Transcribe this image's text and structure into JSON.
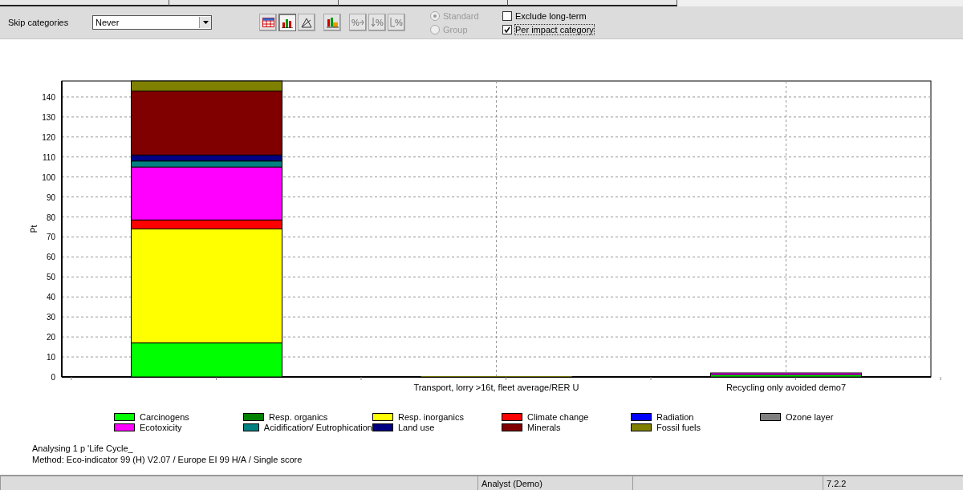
{
  "toolbar": {
    "skip_label": "Skip categories",
    "skip_select": {
      "value": "Never"
    },
    "view_buttons": [
      {
        "kind": "table",
        "selected": false
      },
      {
        "kind": "chart",
        "selected": true
      },
      {
        "kind": "triangle",
        "selected": false
      }
    ],
    "tool_buttons": [
      {
        "kind": "chart-settings",
        "disabled": false
      },
      {
        "kind": "percent",
        "glyph": "%",
        "disabled": true
      },
      {
        "kind": "percent-down",
        "glyph": "%",
        "disabled": true
      },
      {
        "kind": "percent-arrow",
        "glyph": "%",
        "disabled": true
      }
    ],
    "radios": [
      {
        "label": "Standard",
        "selected": true,
        "disabled": true
      },
      {
        "label": "Group",
        "selected": false,
        "disabled": true
      }
    ],
    "checkboxes": [
      {
        "label": "Exclude long-term",
        "checked": false,
        "focused": false
      },
      {
        "label": "Per impact category",
        "checked": true,
        "focused": true
      }
    ]
  },
  "chart": {
    "chart_data": {
      "type": "bar",
      "stacked": true,
      "grid": true,
      "ylabel": "Pt",
      "categories": [
        null,
        "Transport, lorry >16t, fleet average/RER U",
        "Recycling only avoided demo7"
      ],
      "ylim": [
        0,
        148
      ],
      "yticks": [
        0,
        10,
        20,
        30,
        40,
        50,
        60,
        70,
        80,
        90,
        100,
        110,
        120,
        130,
        140
      ],
      "series": [
        {
          "name": "Carcinogens",
          "color": "#00ff00",
          "values": [
            17,
            0,
            1
          ]
        },
        {
          "name": "Resp. organics",
          "color": "#008000",
          "values": [
            0,
            0,
            0
          ]
        },
        {
          "name": "Resp. inorganics",
          "color": "#ffff00",
          "values": [
            57,
            0.3,
            0
          ]
        },
        {
          "name": "Climate change",
          "color": "#ff0000",
          "values": [
            4.5,
            0,
            0
          ]
        },
        {
          "name": "Radiation",
          "color": "#0000ff",
          "values": [
            0,
            0,
            0
          ]
        },
        {
          "name": "Ozone layer",
          "color": "#808080",
          "values": [
            0,
            0,
            0
          ]
        },
        {
          "name": "Ecotoxicity",
          "color": "#ff00ff",
          "values": [
            26.5,
            0,
            1
          ]
        },
        {
          "name": "Acidification/ Eutrophication",
          "color": "#008080",
          "values": [
            3,
            0,
            0
          ]
        },
        {
          "name": "Land use",
          "color": "#000080",
          "values": [
            3,
            0,
            0
          ]
        },
        {
          "name": "Minerals",
          "color": "#800000",
          "values": [
            32,
            0,
            0
          ]
        },
        {
          "name": "Fossil fuels",
          "color": "#808000",
          "values": [
            5,
            0,
            0
          ]
        }
      ]
    }
  },
  "info": [
    "Analysing 1 p 'Life Cycle_",
    "Method: Eco-indicator 99 (H) V2.07 / Europe EI 99 H/A / Single score"
  ],
  "status_bar": [
    "Analyst (Demo)",
    "7.2.2"
  ]
}
